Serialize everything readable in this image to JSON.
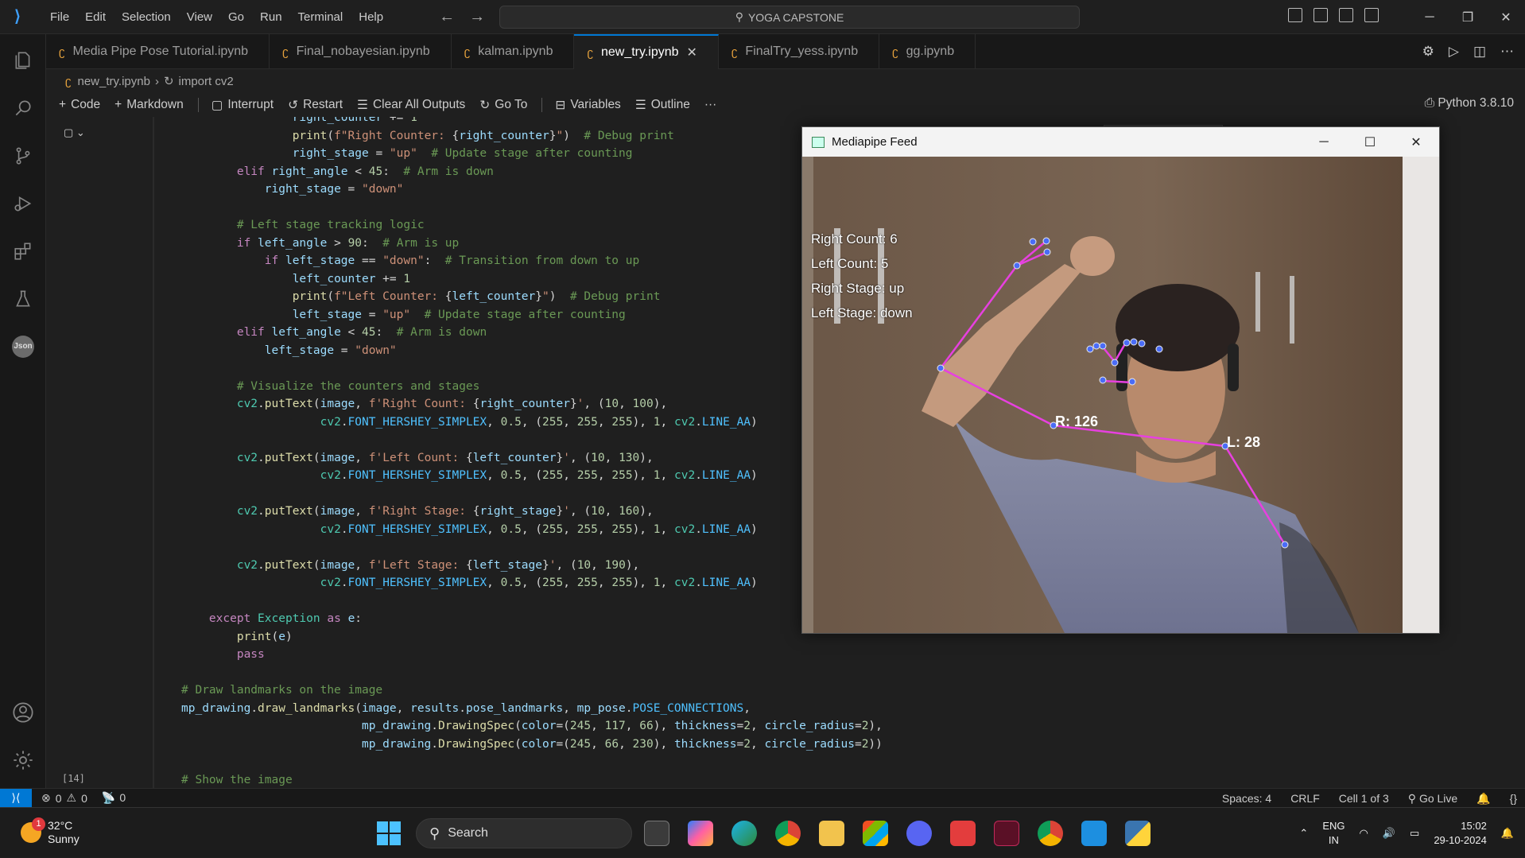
{
  "titlebar": {
    "menu": [
      "File",
      "Edit",
      "Selection",
      "View",
      "Go",
      "Run",
      "Terminal",
      "Help"
    ],
    "search": "YOGA CAPSTONE"
  },
  "tabs": [
    {
      "label": "Media Pipe Pose Tutorial.ipynb"
    },
    {
      "label": "Final_nobayesian.ipynb"
    },
    {
      "label": "kalman.ipynb"
    },
    {
      "label": "new_try.ipynb",
      "active": true
    },
    {
      "label": "FinalTry_yess.ipynb"
    },
    {
      "label": "gg.ipynb"
    }
  ],
  "breadcrumb": {
    "file": "new_try.ipynb",
    "symbol": "import cv2"
  },
  "toolbar": {
    "code": "Code",
    "markdown": "Markdown",
    "interrupt": "Interrupt",
    "restart": "Restart",
    "clear": "Clear All Outputs",
    "goto": "Go To",
    "variables": "Variables",
    "outline": "Outline",
    "more": "···",
    "kernel": "Python 3.8.10"
  },
  "cell": {
    "exec_count": "[14]"
  },
  "popup": {
    "title": "Mediapipe Feed",
    "overlay": [
      "Right Count: 6",
      "Left Count: 5",
      "Right Stage: up",
      "Left Stage: down"
    ],
    "angle_right": "R: 126",
    "angle_left": "L: 28"
  },
  "statusbar": {
    "errors": "0",
    "warnings": "0",
    "ports": "0",
    "spaces": "Spaces: 4",
    "eol": "CRLF",
    "cell": "Cell 1 of 3",
    "golive": "Go Live"
  },
  "taskbar": {
    "temp": "32°C",
    "weather": "Sunny",
    "badge": "1",
    "search": "Search",
    "lang1": "ENG",
    "lang2": "IN",
    "time": "15:02",
    "date": "29-10-2024"
  },
  "colors": {
    "accent": "#0078d4",
    "landmark_line": "#f542e6",
    "landmark_dot": "#4266f5"
  }
}
